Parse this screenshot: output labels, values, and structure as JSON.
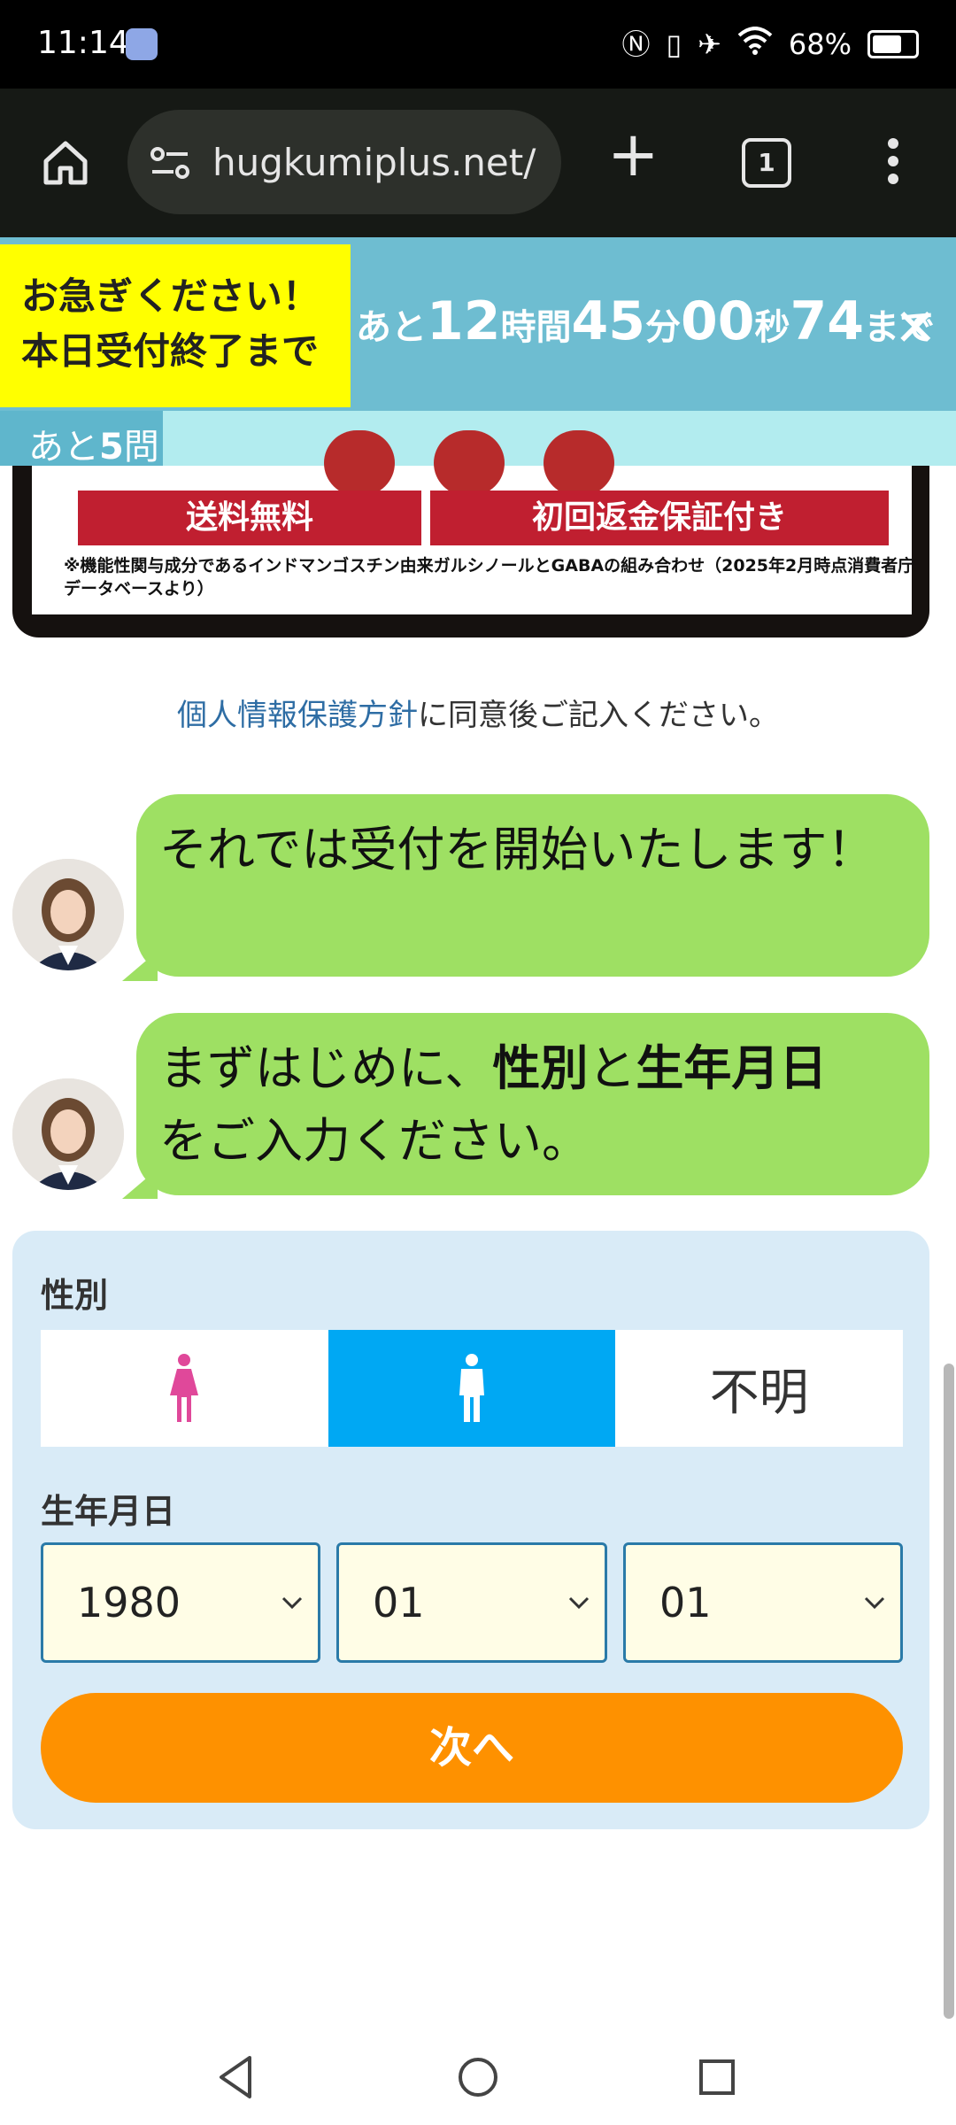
{
  "status_bar": {
    "time": "11:14",
    "battery": "68%",
    "battery_level": 0.68
  },
  "browser": {
    "url": "hugkumiplus.net/",
    "tab_count": "1"
  },
  "countdown": {
    "hurry_line1": "お急ぎください！",
    "hurry_line2": "本日受付終了まで",
    "prefix": "あと",
    "hours": "12",
    "hours_unit": "時間",
    "minutes": "45",
    "minutes_unit": "分",
    "seconds": "00",
    "seconds_unit": "秒",
    "centis": "74",
    "suffix": "まで"
  },
  "progress": {
    "prefix": "あと",
    "count": "5",
    "suffix": "問",
    "fraction": 0.17
  },
  "product": {
    "badge1": "送料無料",
    "badge2": "初回返金保証付き",
    "note": "※機能性関与成分であるインドマンゴスチン由来ガルシノールとGABAの組み合わせ（2025年2月時点消費者庁データベースより）"
  },
  "privacy": {
    "link": "個人情報保護方針",
    "rest": "に同意後ご記入ください。"
  },
  "chat": {
    "msg1": "それでは受付を開始いたします！",
    "msg2_a": "まずはじめに、",
    "msg2_b": "性別",
    "msg2_c": "と",
    "msg2_d": "生年月日",
    "msg2_e": "をご入力ください。"
  },
  "form": {
    "gender_label": "性別",
    "gender_options": [
      "female",
      "male",
      "不明"
    ],
    "gender_selected": "male",
    "birth_label": "生年月日",
    "year": "1980",
    "month": "01",
    "day": "01",
    "next": "次へ"
  },
  "colors": {
    "banner": "#6ebdd1",
    "hurry": "#ffff00",
    "bubble": "#9ee063",
    "form_bg": "#d9ebf7",
    "selected": "#00a8f3",
    "next": "#fe9100",
    "female_icon": "#e0489a"
  }
}
